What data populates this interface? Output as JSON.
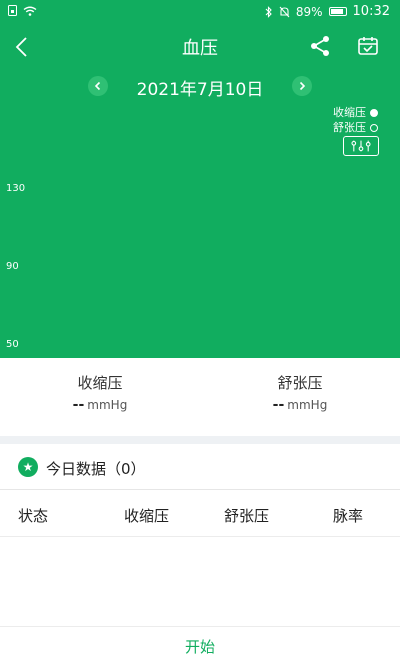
{
  "status_bar": {
    "battery": "89%",
    "time": "10:32"
  },
  "header": {
    "title": "血压"
  },
  "date_nav": {
    "date": "2021年7月10日"
  },
  "legend": {
    "systolic": "收缩压",
    "diastolic": "舒张压"
  },
  "chart_data": {
    "type": "scatter",
    "title": "",
    "ylim": [
      50,
      130
    ],
    "y_ticks": [
      "130",
      "90",
      "50"
    ],
    "series": [
      {
        "name": "收缩压",
        "values": []
      },
      {
        "name": "舒张压",
        "values": []
      }
    ]
  },
  "summary": {
    "systolic_label": "收缩压",
    "diastolic_label": "舒张压",
    "systolic_value": "--",
    "diastolic_value": "--",
    "unit": "mmHg"
  },
  "today": {
    "label": "今日数据（0）"
  },
  "table": {
    "headers": [
      "状态",
      "收缩压",
      "舒张压",
      "脉率"
    ]
  },
  "footer": {
    "start_label": "开始"
  },
  "colors": {
    "accent": "#11ad5f"
  }
}
